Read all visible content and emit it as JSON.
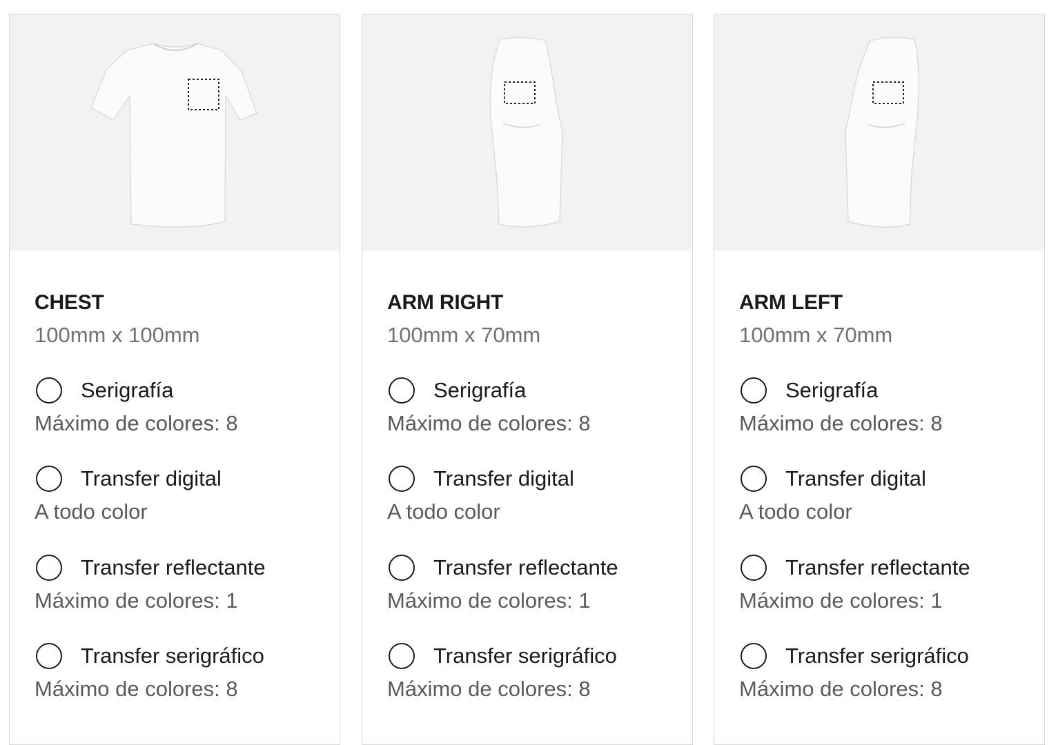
{
  "cards": [
    {
      "view": "front",
      "title": "CHEST",
      "size": "100mm x 100mm",
      "options": [
        {
          "label": "Serigrafía",
          "note": "Máximo de colores: 8",
          "selected": false
        },
        {
          "label": "Transfer digital",
          "note": "A todo color",
          "selected": false
        },
        {
          "label": "Transfer reflectante",
          "note": "Máximo de colores: 1",
          "selected": false
        },
        {
          "label": "Transfer serigráfico",
          "note": "Máximo de colores: 8",
          "selected": false
        }
      ]
    },
    {
      "view": "side-right",
      "title": "ARM RIGHT",
      "size": "100mm x 70mm",
      "options": [
        {
          "label": "Serigrafía",
          "note": "Máximo de colores: 8",
          "selected": false
        },
        {
          "label": "Transfer digital",
          "note": "A todo color",
          "selected": false
        },
        {
          "label": "Transfer reflectante",
          "note": "Máximo de colores: 1",
          "selected": false
        },
        {
          "label": "Transfer serigráfico",
          "note": "Máximo de colores: 8",
          "selected": false
        }
      ]
    },
    {
      "view": "side-left",
      "title": "ARM LEFT",
      "size": "100mm x 70mm",
      "options": [
        {
          "label": "Serigrafía",
          "note": "Máximo de colores: 8",
          "selected": false
        },
        {
          "label": "Transfer digital",
          "note": "A todo color",
          "selected": false
        },
        {
          "label": "Transfer reflectante",
          "note": "Máximo de colores: 1",
          "selected": false
        },
        {
          "label": "Transfer serigráfico",
          "note": "Máximo de colores: 8",
          "selected": false
        }
      ]
    }
  ],
  "colors": {
    "image_background": "#f2f2f2",
    "card_border": "#d9d9d9",
    "shirt": "#ffffff",
    "title_text": "#1a1a1a",
    "muted_text": "#707070"
  }
}
